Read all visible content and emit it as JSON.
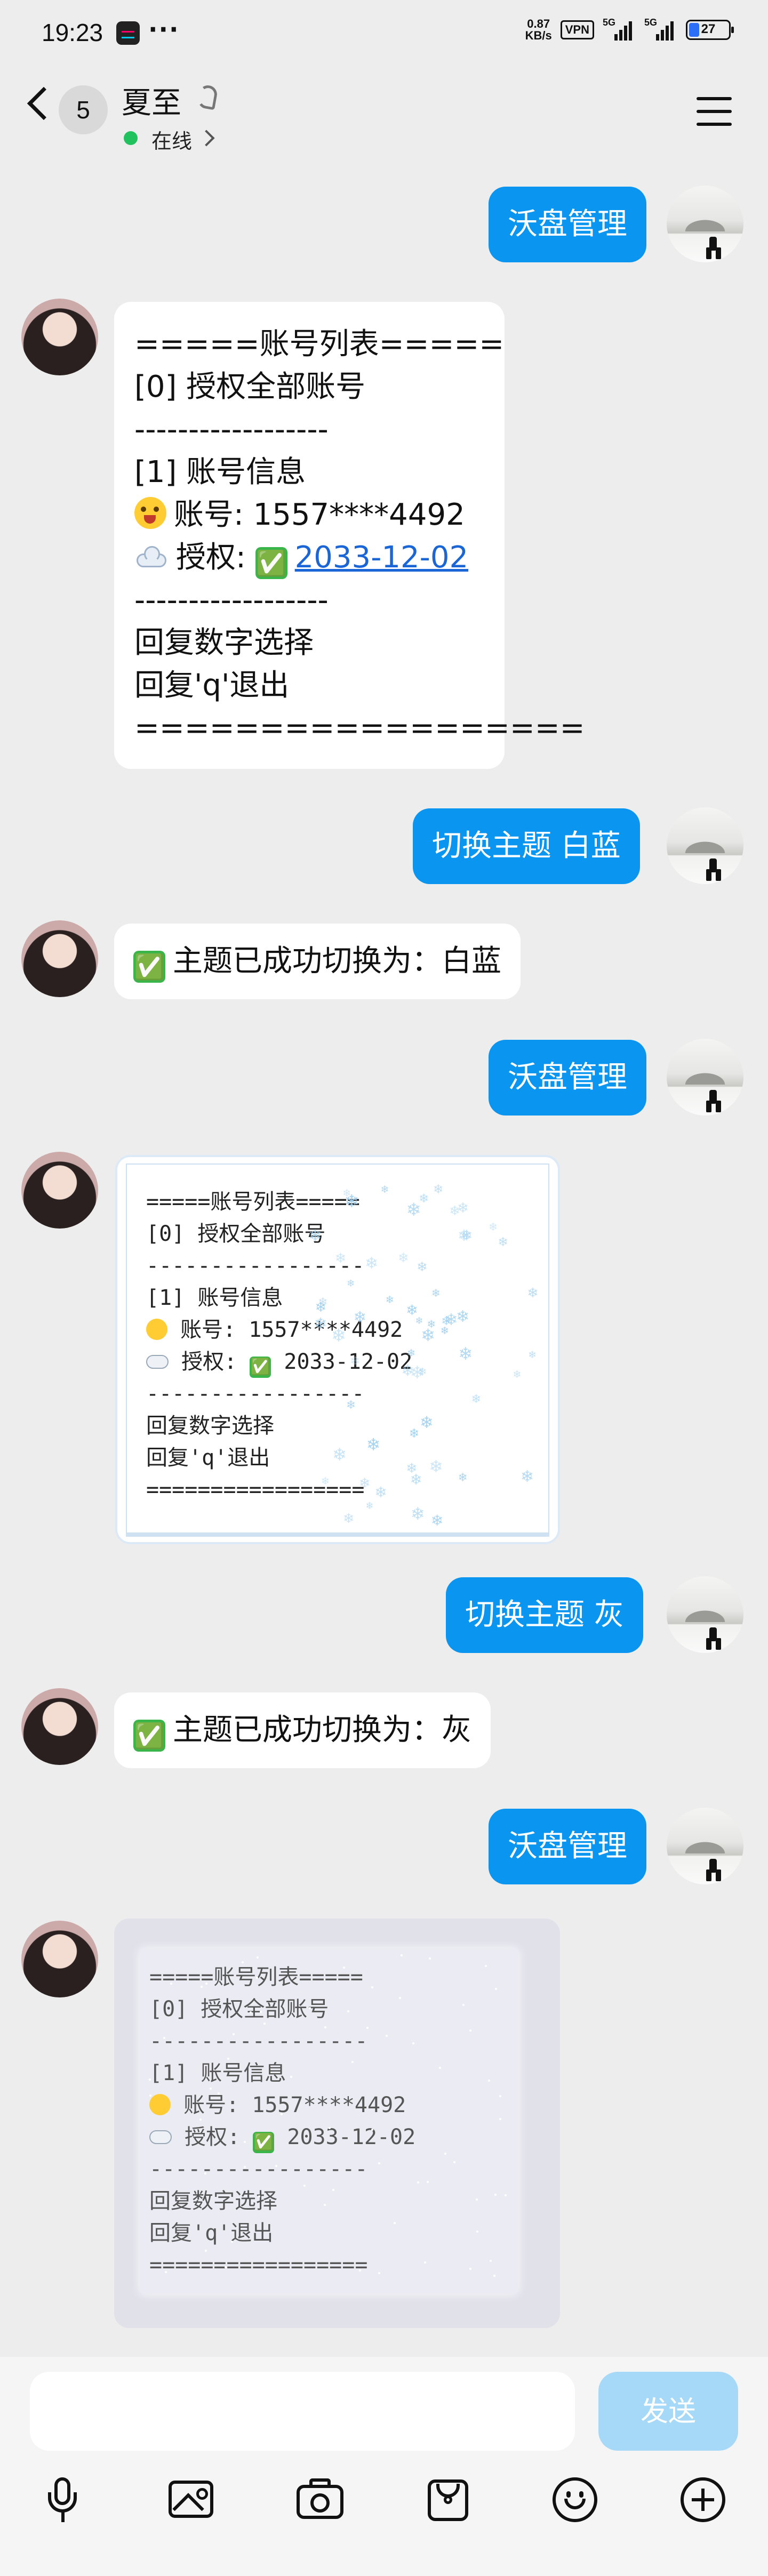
{
  "status_bar": {
    "time": "19:23",
    "more": "···",
    "net_speed_value": "0.87",
    "net_speed_unit": "KB/s",
    "vpn": "VPN",
    "signal1_label": "5G",
    "signal2_label": "5G",
    "battery": "27",
    "battery_level": 0.27
  },
  "header": {
    "unread_count": "5",
    "contact_name": "夏至",
    "presence": "在线"
  },
  "messages": {
    "m1": "沃盘管理",
    "list": {
      "l1": "=====账号列表=====",
      "l2": "[0] 授权全部账号",
      "l3": "------------------",
      "l4": "[1] 账号信息",
      "l5_label": "账号: 1557****4492",
      "l6_label": "授权: ",
      "l6_check": "✅",
      "l6_date": "2033-12-02",
      "l7": "------------------",
      "l8": "回复数字选择",
      "l9": "回复'q'退出",
      "l10": "=================="
    },
    "m3": "切换主题 白蓝",
    "m4_check": "✅",
    "m4": "主题已成功切换为：白蓝",
    "m5": "沃盘管理",
    "card1": {
      "l1": "=====账号列表=====",
      "l2": "[0] 授权全部账号",
      "l3": "-----------------",
      "l4": "[1] 账号信息",
      "l5": "账号: 1557****4492",
      "l6": "授权: ",
      "l6_check": "✅",
      "l6_date": "2033-12-02",
      "l7": "-----------------",
      "l8": "回复数字选择",
      "l9": "回复'q'退出",
      "l10": "================="
    },
    "m7": "切换主题 灰",
    "m8_check": "✅",
    "m8": "主题已成功切换为：灰",
    "m9": "沃盘管理",
    "card2": {
      "l1": "=====账号列表=====",
      "l2": "[0] 授权全部账号",
      "l3": "-----------------",
      "l4": "[1] 账号信息",
      "l5": "账号: 1557****4492",
      "l6": "授权: ",
      "l6_check": "✅",
      "l6_date": "2033-12-02",
      "l7": "-----------------",
      "l8": "回复数字选择",
      "l9": "回复'q'退出",
      "l10": "================="
    }
  },
  "input": {
    "value": "",
    "send_label": "发送"
  },
  "colors": {
    "bubble_blue": "#0a95f0",
    "send_disabled": "#a6d8f8",
    "online": "#21c25e"
  },
  "icons": [
    "back-chevron-icon",
    "ear-icon",
    "menu-icon",
    "mic-icon",
    "image-icon",
    "camera-icon",
    "red-packet-icon",
    "emoji-icon",
    "plus-icon"
  ]
}
